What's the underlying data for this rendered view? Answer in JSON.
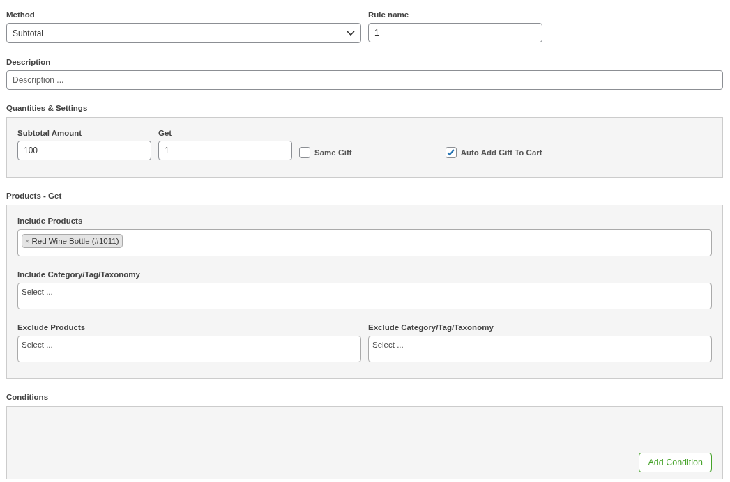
{
  "method": {
    "label": "Method",
    "value": "Subtotal"
  },
  "rule_name": {
    "label": "Rule name",
    "value": "1"
  },
  "description": {
    "label": "Description",
    "placeholder": "Description ..."
  },
  "quantities": {
    "title": "Quantities & Settings",
    "fields": [
      {
        "label": "Subtotal Amount",
        "value": "100"
      },
      {
        "label": "Get",
        "value": "1"
      }
    ],
    "checkboxes": [
      {
        "label": "Same Gift",
        "checked": false
      },
      {
        "label": "Auto Add Gift To Cart",
        "checked": true
      }
    ]
  },
  "products_get": {
    "title": "Products - Get",
    "include_products": {
      "label": "Include Products",
      "tags": [
        "Red Wine Bottle (#1011)"
      ],
      "remove_glyph": "×"
    },
    "include_category": {
      "label": "Include Category/Tag/Taxonomy",
      "placeholder": "Select ..."
    },
    "exclude_products": {
      "label": "Exclude Products",
      "placeholder": "Select ..."
    },
    "exclude_category": {
      "label": "Exclude Category/Tag/Taxonomy",
      "placeholder": "Select ..."
    }
  },
  "conditions": {
    "title": "Conditions",
    "button": "Add Condition"
  }
}
